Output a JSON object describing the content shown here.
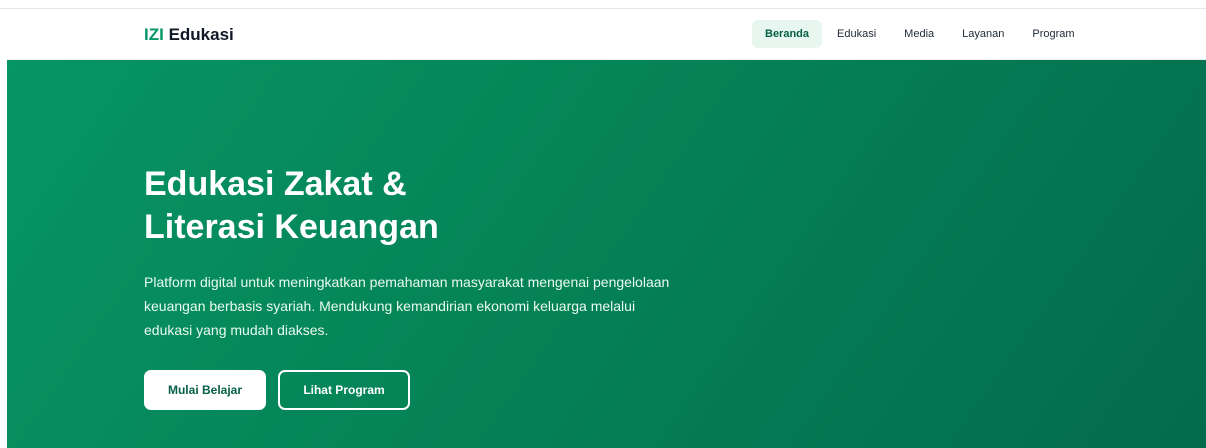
{
  "brand": {
    "accent": "IZI",
    "name": "Edukasi"
  },
  "nav": {
    "items": [
      {
        "label": "Beranda",
        "active": true
      },
      {
        "label": "Edukasi",
        "active": false
      },
      {
        "label": "Media",
        "active": false
      },
      {
        "label": "Layanan",
        "active": false
      },
      {
        "label": "Program",
        "active": false
      }
    ]
  },
  "hero": {
    "title_line1": "Edukasi Zakat &",
    "title_line2": "Literasi Keuangan",
    "description_line1": "Platform digital untuk meningkatkan pemahaman masyarakat mengenai pengelolaan",
    "description_line2": "keuangan berbasis syariah. Mendukung kemandirian ekonomi keluarga melalui",
    "description_line3": "edukasi yang mudah diakses.",
    "primary_button": "Mulai Belajar",
    "secondary_button": "Lihat Program"
  },
  "colors": {
    "brand_accent": "#059669",
    "hero_gradient_start": "#069565",
    "hero_gradient_end": "#036b4c",
    "active_nav_bg": "#e7f6ee"
  }
}
